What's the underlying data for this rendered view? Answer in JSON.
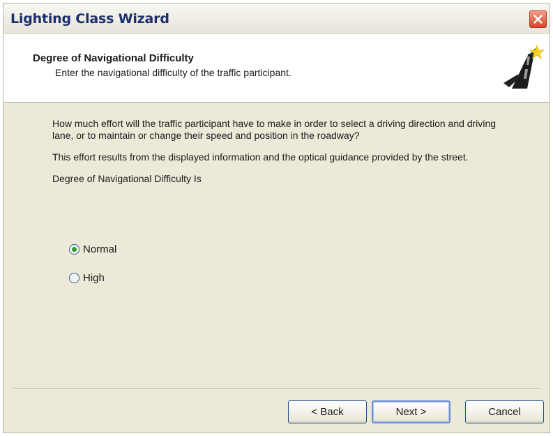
{
  "window": {
    "title": "Lighting Class Wizard"
  },
  "header": {
    "title": "Degree of Navigational Difficulty",
    "subtitle": "Enter the navigational difficulty of the traffic participant."
  },
  "body": {
    "question": "How much effort will the traffic participant have to make in order to select a driving direction and driving lane, or to maintain or change their speed and position in the roadway?",
    "explanation": "This effort results from the displayed information and the optical guidance provided by the street.",
    "group_label": "Degree of Navigational Difficulty Is",
    "options": [
      {
        "label": "Normal",
        "selected": true
      },
      {
        "label": "High",
        "selected": false
      }
    ]
  },
  "buttons": {
    "back": "< Back",
    "next": "Next >",
    "cancel": "Cancel"
  }
}
